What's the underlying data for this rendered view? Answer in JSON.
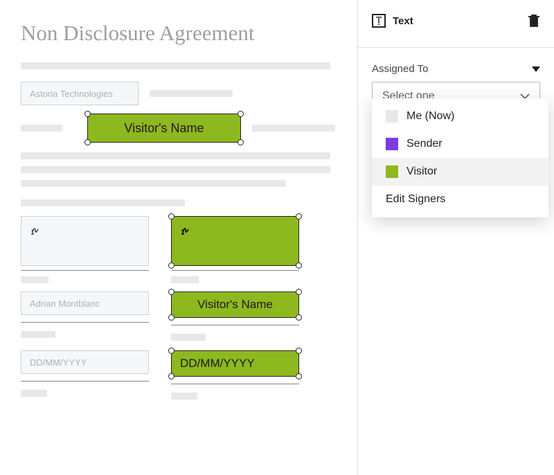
{
  "document": {
    "title": "Non Disclosure Agreement",
    "company_field": "Astoria Technologies",
    "visitor_name_field": "Visitor's Name",
    "name_field": "Adrian Montblanc",
    "date_field": "DD/MM/YYYY",
    "visitor_name_small": "Visitor's Name",
    "visitor_date_small": "DD/MM/YYYY"
  },
  "properties": {
    "header_label": "Text",
    "assigned_to_label": "Assigned To",
    "select_placeholder": "Select one",
    "dropdown": {
      "me_now": "Me (Now)",
      "sender": "Sender",
      "visitor": "Visitor",
      "edit_signers": "Edit Signers"
    }
  },
  "colors": {
    "visitor_green": "#8eb81f",
    "sender_purple": "#7a3de0"
  }
}
